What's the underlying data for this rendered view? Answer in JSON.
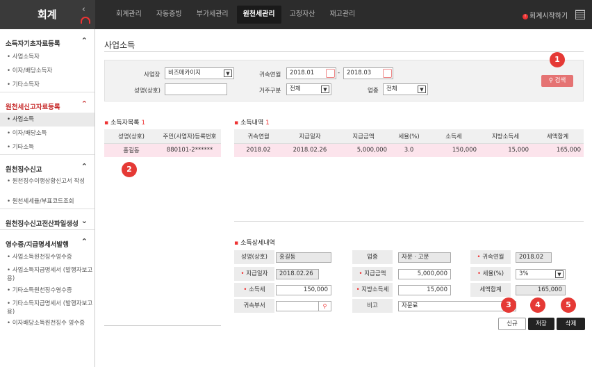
{
  "app_title": "회계",
  "nav": [
    "회계관리",
    "자동증빙",
    "부가세관리",
    "원천세관리",
    "고정자산",
    "재고관리"
  ],
  "start_link": "회계시작하기",
  "sidebar": {
    "groups": [
      {
        "title": "소득자기초자료등록",
        "items": [
          "사업소득자",
          "이자/배당소득자",
          "기타소득자"
        ]
      },
      {
        "title": "원천세신고자료등록",
        "items": [
          "사업소득",
          "이자/배당소득",
          "기타소득"
        ]
      },
      {
        "title": "원천징수신고",
        "items": [
          "원천징수이행상황신고서 작성",
          "원천세세율/부표코드조회"
        ]
      },
      {
        "title": "원천징수신고전산파일생성",
        "items": []
      },
      {
        "title": "영수증/지급명세서발행",
        "items": [
          "사업소득원천징수영수증",
          "사업소득지급명세서 (발행자보고용)",
          "기타소득원천징수영수증",
          "기타소득지급명세서 (발행자보고용)",
          "이자배당소득원천징수 영수증"
        ]
      }
    ]
  },
  "page_title": "사업소득",
  "filter": {
    "business_label": "사업장",
    "business_value": "비즈메카이지",
    "name_label": "성명(상호)",
    "name_value": "",
    "period_label": "귀속연월",
    "period_from": "2018.01",
    "period_sep": "-",
    "period_to": "2018.03",
    "residence_label": "거주구분",
    "residence_value": "전체",
    "industry_label": "업종",
    "industry_value": "전체",
    "search_label": "검색"
  },
  "earner_list": {
    "title": "소득자목록",
    "count": "1",
    "columns": [
      "성명(상호)",
      "주민(사업자)등록번호"
    ],
    "rows": [
      [
        "홍길동",
        "880101-2******"
      ]
    ]
  },
  "income_list": {
    "title": "소득내역",
    "count": "1",
    "columns": [
      "귀속연월",
      "지급일자",
      "지급금액",
      "세율(%)",
      "소득세",
      "지방소득세",
      "세액합계"
    ],
    "rows": [
      [
        "2018.02",
        "2018.02.26",
        "5,000,000",
        "3.0",
        "150,000",
        "15,000",
        "165,000"
      ]
    ]
  },
  "detail": {
    "title": "소득상세내역",
    "name_label": "성명(상호)",
    "name_value": "홍길동",
    "industry_label": "업종",
    "industry_value": "자문 · 고문",
    "period_label": "귀속연월",
    "period_value": "2018.02",
    "paydate_label": "지급일자",
    "paydate_value": "2018.02.26",
    "amount_label": "지급금액",
    "amount_value": "5,000,000",
    "rate_label": "세율(%)",
    "rate_value": "3%",
    "incometax_label": "소득세",
    "incometax_value": "150,000",
    "localtax_label": "지방소득세",
    "localtax_value": "15,000",
    "total_label": "세액합계",
    "total_value": "165,000",
    "dept_label": "귀속부서",
    "dept_value": "",
    "memo_label": "비고",
    "memo_value": "자문료"
  },
  "buttons": {
    "new": "신규",
    "save": "저장",
    "delete": "삭제"
  },
  "markers": [
    "1",
    "2",
    "3",
    "4",
    "5"
  ]
}
